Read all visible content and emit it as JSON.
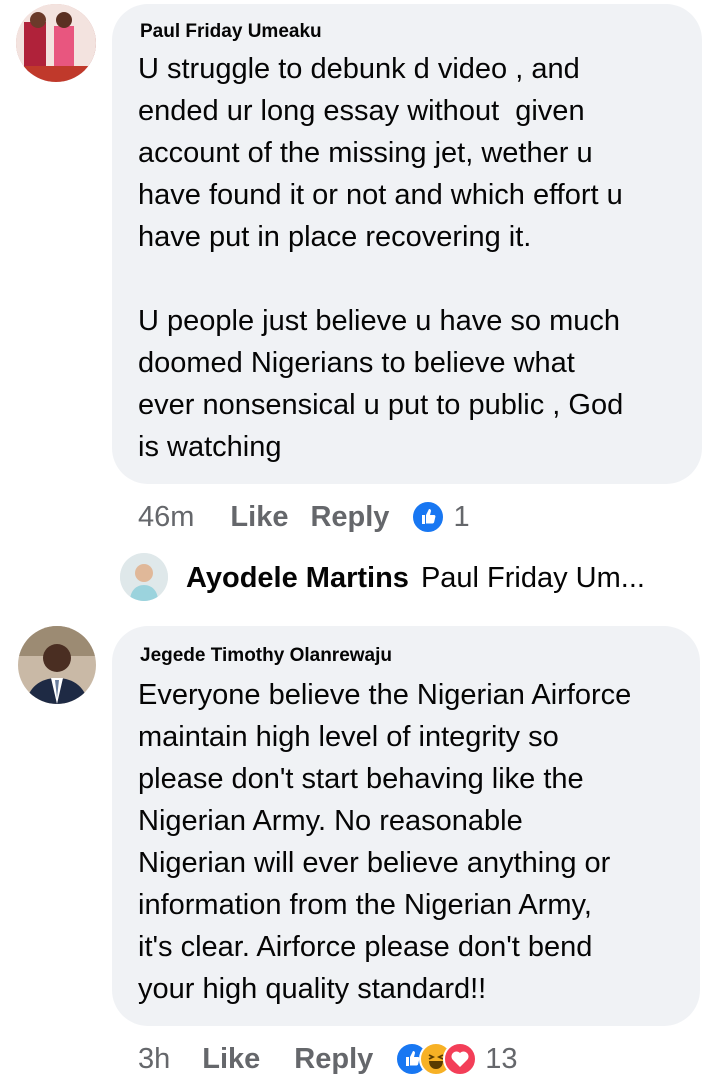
{
  "comments": [
    {
      "author": "Paul Friday Umeaku",
      "text": "U struggle to debunk d video , and\nended ur long essay without  given\naccount of the missing jet, wether u\nhave found it or not and which effort u\nhave put in place recovering it.\n\nU people just believe u have so much\ndoomed Nigerians to believe what\never nonsensical u put to public , God\nis watching",
      "time": "46m",
      "like_label": "Like",
      "reply_label": "Reply",
      "reaction_count": "1",
      "reactions": [
        "like-icon"
      ]
    },
    {
      "author": "Jegede Timothy Olanrewaju",
      "text": "Everyone believe the Nigerian Airforce\nmaintain high level of integrity so\nplease don't start behaving like the\nNigerian Army. No reasonable\nNigerian will ever believe anything or\ninformation from the Nigerian Army,\nit's clear. Airforce please don't bend\nyour high quality standard!!",
      "time": "3h",
      "like_label": "Like",
      "reply_label": "Reply",
      "reaction_count": "13",
      "reactions": [
        "like-icon",
        "haha-icon",
        "love-icon"
      ]
    }
  ],
  "reply_preview": {
    "author": "Ayodele Martins",
    "text": "Paul Friday Um..."
  },
  "colors": {
    "bubble": "#f0f2f5",
    "meta": "#65676b",
    "like_blue": "#1877f2"
  }
}
